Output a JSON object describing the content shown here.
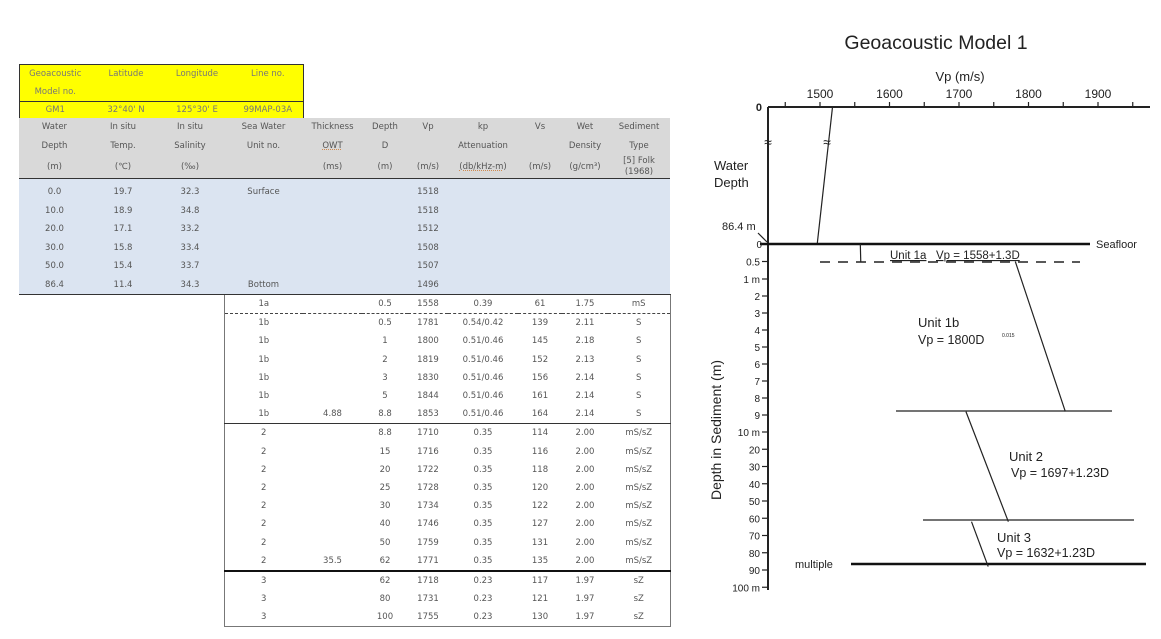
{
  "model_header": {
    "columns": [
      "Geoacoustic Model no.",
      "Latitude",
      "Longitude",
      "Line no."
    ],
    "values": [
      "GM1",
      "32°40' N",
      "125°30' E",
      "99MAP-03A"
    ]
  },
  "table": {
    "headers": [
      [
        "Water",
        "In situ",
        "In situ",
        "Sea Water",
        "Thickness",
        "Depth",
        "Vp",
        "kp",
        "Vs",
        "Wet",
        "Sediment"
      ],
      [
        "Depth",
        "Temp.",
        "Salinity",
        "Unit no.",
        "OWT",
        "D",
        "",
        "Attenuation",
        "",
        "Density",
        "Type"
      ],
      [
        "(m)",
        "(℃)",
        "(‰)",
        "",
        "(ms)",
        "(m)",
        "(m/s)",
        "(db/kHz-m)",
        "(m/s)",
        "(g/cm³)",
        "[5] Folk (1968)"
      ]
    ],
    "water_rows": [
      [
        "0.0",
        "19.7",
        "32.3",
        "Surface",
        "",
        "",
        "1518",
        "",
        "",
        "",
        ""
      ],
      [
        "10.0",
        "18.9",
        "34.8",
        "",
        "",
        "",
        "1518",
        "",
        "",
        "",
        ""
      ],
      [
        "20.0",
        "17.1",
        "33.2",
        "",
        "",
        "",
        "1512",
        "",
        "",
        "",
        ""
      ],
      [
        "30.0",
        "15.8",
        "33.4",
        "",
        "",
        "",
        "1508",
        "",
        "",
        "",
        ""
      ],
      [
        "50.0",
        "15.4",
        "33.7",
        "",
        "",
        "",
        "1507",
        "",
        "",
        "",
        ""
      ],
      [
        "86.4",
        "11.4",
        "34.3",
        "Bottom",
        "",
        "",
        "1496",
        "",
        "",
        "",
        ""
      ]
    ],
    "sediment_rows": [
      [
        "1a",
        "",
        "0.5",
        "1558",
        "0.39",
        "61",
        "1.75",
        "mS"
      ],
      [
        "1b",
        "",
        "0.5",
        "1781",
        "0.54/0.42",
        "139",
        "2.11",
        "S"
      ],
      [
        "1b",
        "",
        "1",
        "1800",
        "0.51/0.46",
        "145",
        "2.18",
        "S"
      ],
      [
        "1b",
        "",
        "2",
        "1819",
        "0.51/0.46",
        "152",
        "2.13",
        "S"
      ],
      [
        "1b",
        "",
        "3",
        "1830",
        "0.51/0.46",
        "156",
        "2.14",
        "S"
      ],
      [
        "1b",
        "",
        "5",
        "1844",
        "0.51/0.46",
        "161",
        "2.14",
        "S"
      ],
      [
        "1b",
        "4.88",
        "8.8",
        "1853",
        "0.51/0.46",
        "164",
        "2.14",
        "S"
      ],
      [
        "2",
        "",
        "8.8",
        "1710",
        "0.35",
        "114",
        "2.00",
        "mS/sZ"
      ],
      [
        "2",
        "",
        "15",
        "1716",
        "0.35",
        "116",
        "2.00",
        "mS/sZ"
      ],
      [
        "2",
        "",
        "20",
        "1722",
        "0.35",
        "118",
        "2.00",
        "mS/sZ"
      ],
      [
        "2",
        "",
        "25",
        "1728",
        "0.35",
        "120",
        "2.00",
        "mS/sZ"
      ],
      [
        "2",
        "",
        "30",
        "1734",
        "0.35",
        "122",
        "2.00",
        "mS/sZ"
      ],
      [
        "2",
        "",
        "40",
        "1746",
        "0.35",
        "127",
        "2.00",
        "mS/sZ"
      ],
      [
        "2",
        "",
        "50",
        "1759",
        "0.35",
        "131",
        "2.00",
        "mS/sZ"
      ],
      [
        "2",
        "35.5",
        "62",
        "1771",
        "0.35",
        "135",
        "2.00",
        "mS/sZ"
      ],
      [
        "3",
        "",
        "62",
        "1718",
        "0.23",
        "117",
        "1.97",
        "sZ"
      ],
      [
        "3",
        "",
        "80",
        "1731",
        "0.23",
        "121",
        "1.97",
        "sZ"
      ],
      [
        "3",
        "",
        "100",
        "1755",
        "0.23",
        "130",
        "1.97",
        "sZ"
      ]
    ]
  },
  "diagram": {
    "title": "Geoacoustic Model  1",
    "x_axis_label": "Vp (m/s)",
    "x_ticks": [
      "1500",
      "1600",
      "1700",
      "1800",
      "1900"
    ],
    "water_axis_top_label": "0",
    "water_label": [
      "Water",
      "Depth"
    ],
    "water_depth_label": "86.4 m",
    "seafloor_label": "Seafloor",
    "y_axis_label": "Depth in Sediment (m)",
    "depth_ticks": [
      "0",
      "0.5",
      "1 m",
      "2",
      "3",
      "4",
      "5",
      "6",
      "7",
      "8",
      "9",
      "10 m",
      "20",
      "30",
      "40",
      "50",
      "60",
      "70",
      "80",
      "90",
      "100 m"
    ],
    "multiple_label": "multiple",
    "units": [
      {
        "name": "Unit 1a",
        "equation": "Vp = 1558+1.3D",
        "profile": [
          [
            1558,
            0
          ],
          [
            1558.65,
            0.5
          ]
        ]
      },
      {
        "name": "Unit 1b",
        "equation": "Vp = 1800D",
        "exponent": "0.015",
        "profile": [
          [
            1781,
            0.5
          ],
          [
            1853,
            8.8
          ]
        ]
      },
      {
        "name": "Unit 2",
        "equation": "Vp = 1697+1.23D",
        "profile": [
          [
            1710,
            8.8
          ],
          [
            1771,
            62
          ]
        ]
      },
      {
        "name": "Unit 3",
        "equation": "Vp = 1632+1.23D",
        "profile": [
          [
            1718,
            62
          ],
          [
            1742,
            88
          ]
        ]
      }
    ],
    "water_profile": [
      [
        1518,
        0
      ],
      [
        1496,
        86.4
      ]
    ]
  }
}
